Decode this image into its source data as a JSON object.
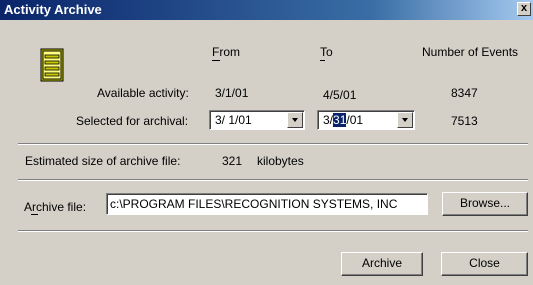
{
  "window": {
    "title": "Activity Archive",
    "close_glyph": "x"
  },
  "icons": {
    "archive": "file-cabinet-icon"
  },
  "columns": {
    "from": "From",
    "to": "To",
    "events": "Number of Events"
  },
  "available": {
    "label": "Available activity:",
    "from": "3/1/01",
    "to": "4/5/01",
    "events": "8347"
  },
  "selected": {
    "label": "Selected for archival:",
    "from_value": "3/ 1/01",
    "to_prefix": "3/",
    "to_highlight": "31",
    "to_suffix": "/01",
    "events": "7513"
  },
  "size": {
    "label": "Estimated size of archive file:",
    "value": "321",
    "unit": "kilobytes"
  },
  "archive_file": {
    "label": "Archive file:",
    "value": "c:\\PROGRAM FILES\\RECOGNITION SYSTEMS, INC"
  },
  "buttons": {
    "browse": "Browse...",
    "archive": "Archive",
    "close": "Close"
  },
  "colors": {
    "titlebar": "#0a246a",
    "face": "#d4d0c8",
    "highlight": "#0a246a"
  }
}
